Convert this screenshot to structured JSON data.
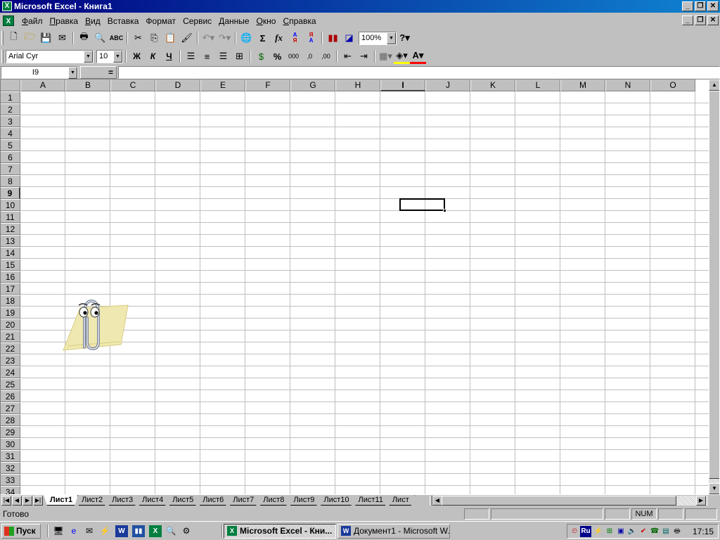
{
  "window": {
    "title": "Microsoft Excel - Книга1",
    "minimize": "_",
    "restore": "❐",
    "close": "✕"
  },
  "menu": {
    "items": [
      {
        "label": "Файл",
        "key": "Ф",
        "rest": "айл"
      },
      {
        "label": "Правка",
        "key": "П",
        "rest": "равка"
      },
      {
        "label": "Вид",
        "key": "В",
        "rest": "ид"
      },
      {
        "label": "Вставка",
        "key": "В",
        "rest": "ставка"
      },
      {
        "label": "Формат",
        "key": "Ф",
        "rest": "ормат"
      },
      {
        "label": "Сервис",
        "key": "С",
        "rest": "ервис"
      },
      {
        "label": "Данные",
        "key": "Д",
        "rest": "анные"
      },
      {
        "label": "Окно",
        "key": "О",
        "rest": "кно"
      },
      {
        "label": "Справка",
        "key": "С",
        "rest": "правка"
      }
    ]
  },
  "standard_toolbar": {
    "zoom": "100%",
    "sum_symbol": "Σ",
    "function_symbol": "fx"
  },
  "format_toolbar": {
    "font": "Arial Cyr",
    "size": "10",
    "bold": "Ж",
    "italic": "К",
    "underline": "Ч",
    "percent": "%",
    "thousands": "000",
    "inc_decimal": "‚0",
    "dec_decimal": ",00"
  },
  "formula_bar": {
    "name_box": "I9",
    "equals": "=",
    "value": ""
  },
  "grid": {
    "columns": [
      "A",
      "B",
      "C",
      "D",
      "E",
      "F",
      "G",
      "H",
      "I",
      "J",
      "K",
      "L",
      "M",
      "N",
      "O"
    ],
    "rows": [
      "1",
      "2",
      "3",
      "4",
      "5",
      "6",
      "7",
      "8",
      "9",
      "10",
      "11",
      "12",
      "13",
      "14",
      "15",
      "16",
      "17",
      "18",
      "19",
      "20",
      "21",
      "22",
      "23",
      "24",
      "25",
      "26",
      "27",
      "28",
      "29",
      "30",
      "31",
      "32",
      "33",
      "34"
    ],
    "active_column": "I",
    "active_row": "9"
  },
  "sheets": {
    "tabs": [
      "Лист1",
      "Лист2",
      "Лист3",
      "Лист4",
      "Лист5",
      "Лист6",
      "Лист7",
      "Лист8",
      "Лист9",
      "Лист10",
      "Лист11",
      "Лист"
    ],
    "active": "Лист1"
  },
  "status": {
    "text": "Готово",
    "num": "NUM"
  },
  "taskbar": {
    "start": "Пуск",
    "tasks": [
      {
        "label": "Microsoft Excel - Кни...",
        "active": true
      },
      {
        "label": "Документ1 - Microsoft W...",
        "active": false
      }
    ],
    "tray_lang": "Ru",
    "clock": "17:15"
  }
}
